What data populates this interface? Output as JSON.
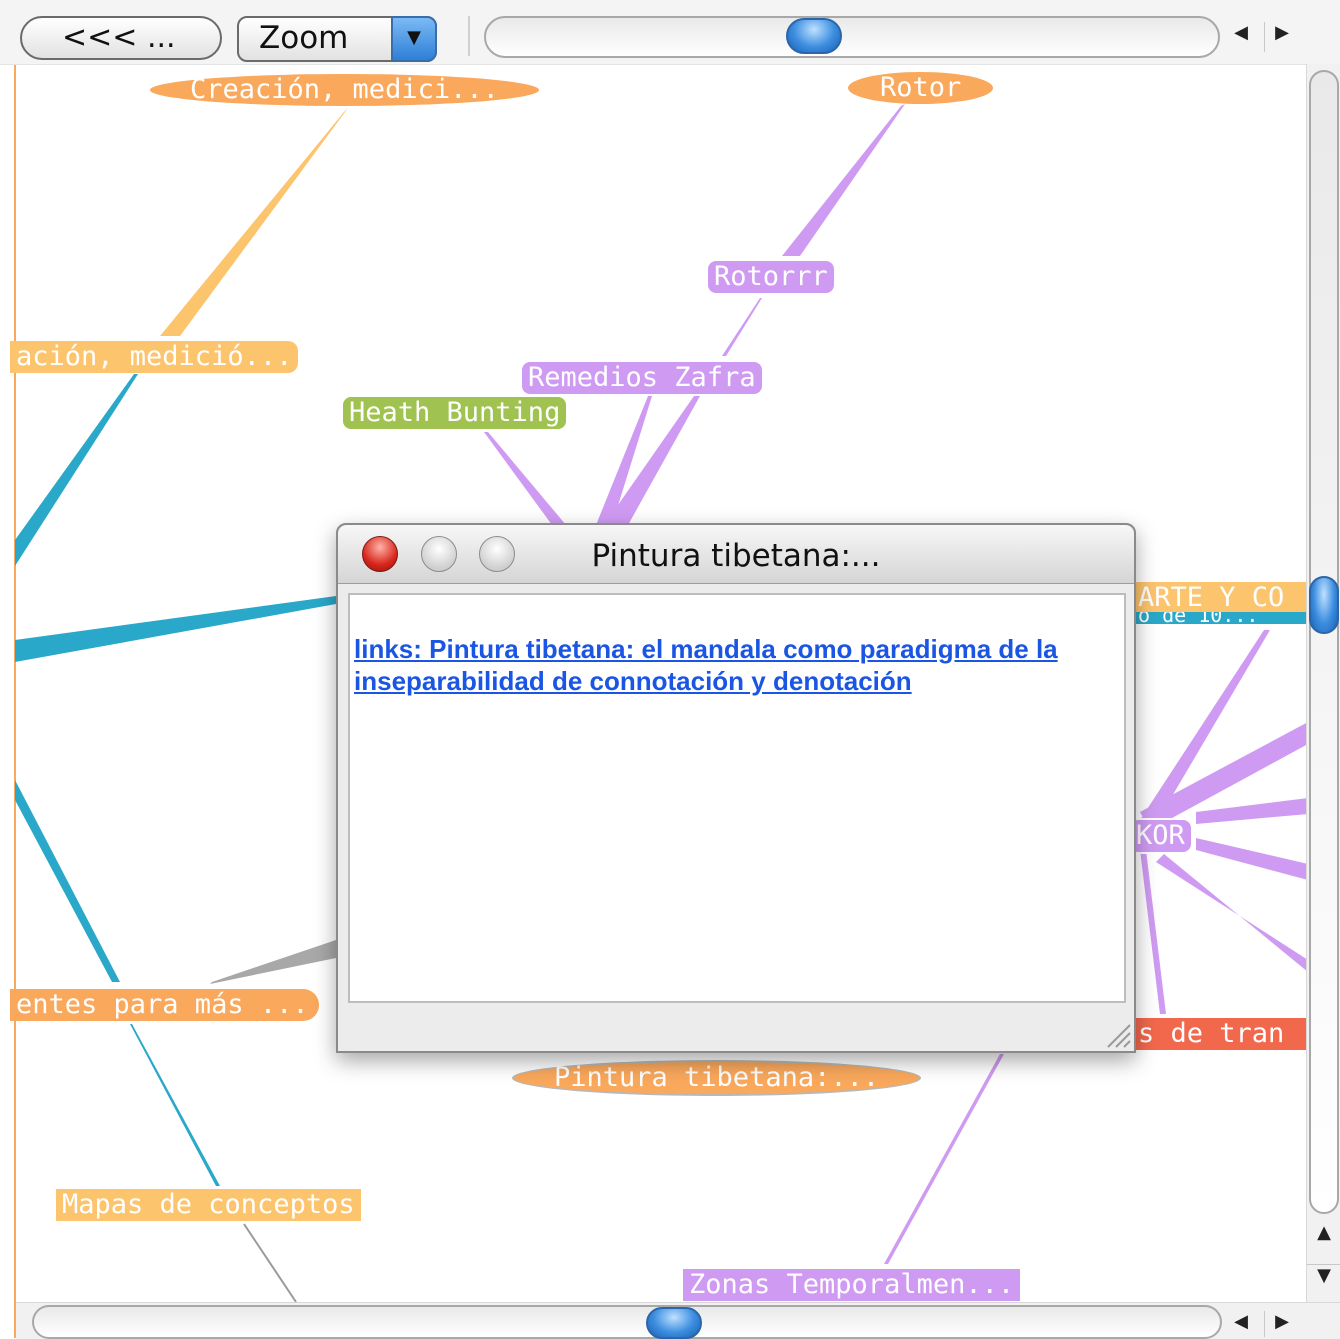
{
  "toolbar": {
    "back_label": "<<< ...",
    "zoom_label": "Zoom",
    "zoom_arrow_icon": "triangle-down-icon",
    "hscroll_left_icon": "triangle-left-icon",
    "hscroll_right_icon": "triangle-right-icon"
  },
  "graph": {
    "nodes": {
      "creacion_top": "Creación, medici...",
      "rotor": "Rotor",
      "rotorrr": "Rotorrr",
      "creacion_left": "ación, medició...",
      "remedios": "Remedios Zafra",
      "heath": "Heath Bunting",
      "arte": "ARTE Y CO",
      "arte_sub": "o de 10...",
      "kor": "KOR",
      "fuentes": "entes para más ...",
      "trans": "s de tran",
      "pintura": "Pintura tibetana:...",
      "mapas": "Mapas de conceptos",
      "zonas": "Zonas Temporalmen..."
    },
    "colors": {
      "orange": "#f9a85c",
      "yellow": "#fdc46e",
      "purple": "#cf9bf2",
      "green": "#9fc250",
      "red": "#f2684d",
      "teal": "#2aa8c9"
    }
  },
  "dialog": {
    "title": "Pintura tibetana:...",
    "link_text": "links: Pintura tibetana: el mandala como paradigma de la inseparabilidad de connotación y denotación"
  },
  "scrollbars": {
    "up_icon": "triangle-up-icon",
    "down_icon": "triangle-down-icon",
    "left_icon": "triangle-left-icon",
    "right_icon": "triangle-right-icon"
  }
}
